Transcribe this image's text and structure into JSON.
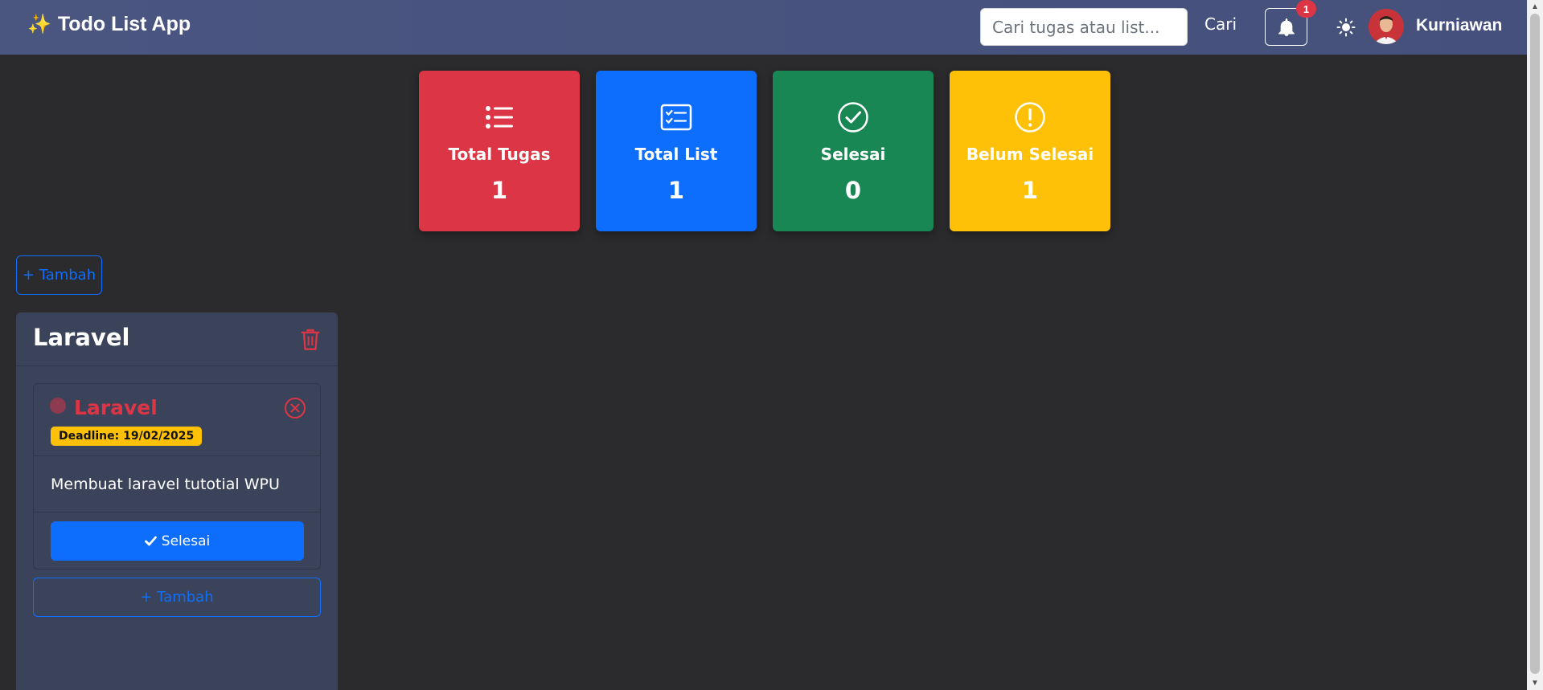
{
  "navbar": {
    "brand_icon": "sparkles-icon",
    "brand": "Todo List App",
    "search_placeholder": "Cari tugas atau list...",
    "search_button": "Cari",
    "notification_count": "1",
    "username": "Kurniawan"
  },
  "stats": [
    {
      "label": "Total Tugas",
      "value": "1",
      "color": "#dc3545",
      "icon": "list-icon"
    },
    {
      "label": "Total List",
      "value": "1",
      "color": "#0d6efd",
      "icon": "checklist-icon"
    },
    {
      "label": "Selesai",
      "value": "0",
      "color": "#198754",
      "icon": "check-circle-icon"
    },
    {
      "label": "Belum Selesai",
      "value": "1",
      "color": "#ffc107",
      "icon": "exclamation-circle-icon"
    }
  ],
  "add_list_button": "+ Tambah",
  "lists": [
    {
      "title": "Laravel",
      "tasks": [
        {
          "title": "Laravel",
          "deadline": "Deadline: 19/02/2025",
          "description": "Membuat laravel tutotial WPU",
          "done_button": "Selesai"
        }
      ],
      "add_task_button": "+ Tambah"
    }
  ]
}
